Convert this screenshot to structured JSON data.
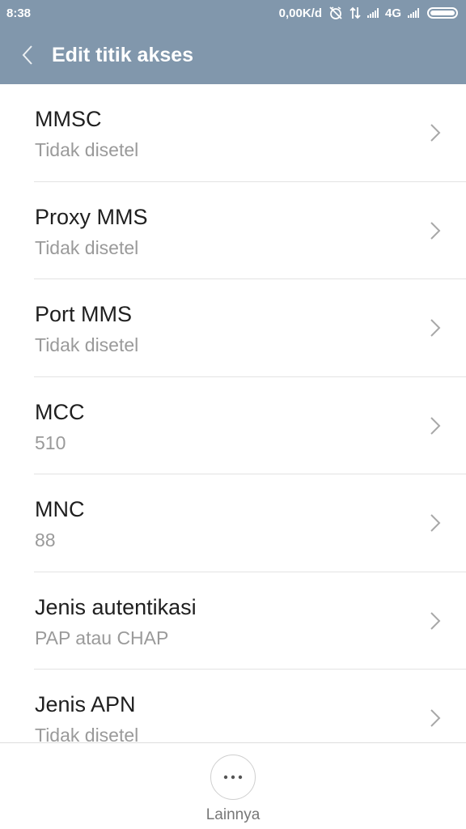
{
  "status_bar": {
    "time": "8:38",
    "data_speed": "0,00K/d",
    "network_type": "4G",
    "icons": [
      "alarm-off-icon",
      "data-transfer-icon",
      "signal-icon",
      "signal-icon",
      "battery-icon"
    ]
  },
  "header": {
    "title": "Edit titik akses",
    "back_icon": "chevron-left-icon",
    "background": "#8197ac"
  },
  "settings": [
    {
      "label": "MMSC",
      "value": "Tidak disetel"
    },
    {
      "label": "Proxy MMS",
      "value": "Tidak disetel"
    },
    {
      "label": "Port MMS",
      "value": "Tidak disetel"
    },
    {
      "label": "MCC",
      "value": "510"
    },
    {
      "label": "MNC",
      "value": "88"
    },
    {
      "label": "Jenis autentikasi",
      "value": "PAP atau CHAP"
    },
    {
      "label": "Jenis APN",
      "value": "Tidak disetel"
    }
  ],
  "bottom_bar": {
    "more_icon": "more-horizontal-icon",
    "more_label": "Lainnya"
  }
}
